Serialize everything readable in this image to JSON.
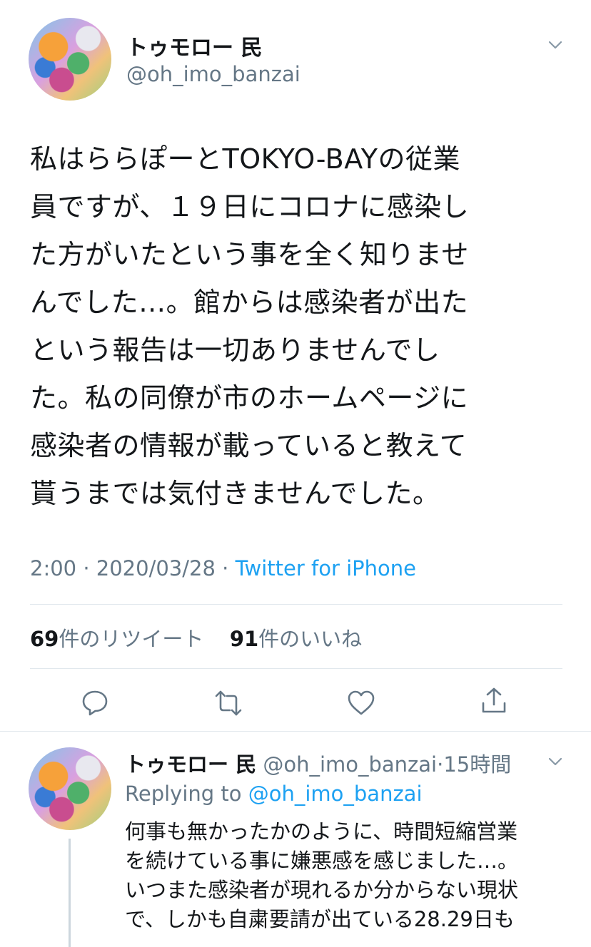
{
  "main_tweet": {
    "display_name": "トゥモロー 民",
    "handle": "@oh_imo_banzai",
    "text_lines": [
      "私はららぽーとTOKYO-BAYの従業",
      "員ですが、１９日にコロナに感染し",
      "た方がいたという事を全く知りませ",
      "んでした…。館からは感染者が出た",
      "という報告は一切ありませんでし",
      "た。私の同僚が市のホームページに",
      "感染者の情報が載っていると教えて",
      "貰うまでは気付きませんでした。"
    ],
    "time": "2:00",
    "date": "2020/03/28",
    "separator": "·",
    "source": "Twitter for iPhone",
    "retweet_count": "69",
    "retweet_label": "件のリツイート",
    "like_count": "91",
    "like_label": "件のいいね"
  },
  "icons": {
    "more": "chevron-down-icon",
    "reply": "reply-icon",
    "retweet": "retweet-icon",
    "like": "like-icon",
    "share": "share-icon"
  },
  "reply_tweet": {
    "display_name": "トゥモロー 民",
    "handle": "@oh_imo_banzai",
    "dot": "·",
    "age": "15時間",
    "replying_to_label": "Replying to",
    "replying_to_handle": "@oh_imo_banzai",
    "text_lines": [
      "何事も無かったかのように、時間短縮営業",
      "を続けている事に嫌悪感を感じました…。",
      "いつまた感染者が現れるか分からない現状",
      "で、しかも自粛要請が出ている28.29日も"
    ]
  },
  "colors": {
    "accent": "#1da1f2",
    "secondary_text": "#657786",
    "divider": "#e1e8ed"
  }
}
